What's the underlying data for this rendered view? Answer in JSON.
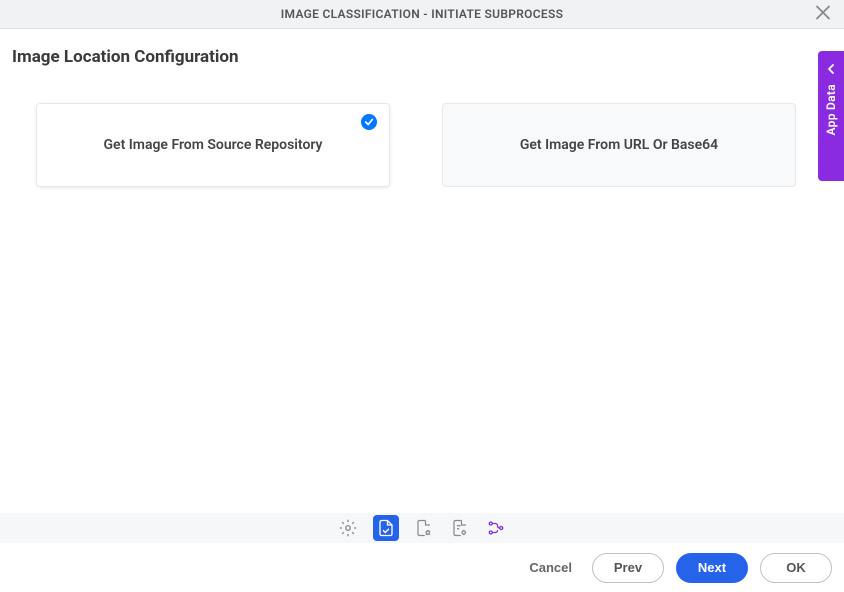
{
  "header": {
    "title": "IMAGE CLASSIFICATION - INITIATE SUBPROCESS"
  },
  "page": {
    "title": "Image Location Configuration"
  },
  "cards": [
    {
      "label": "Get Image From Source Repository",
      "selected": true
    },
    {
      "label": "Get Image From URL Or Base64",
      "selected": false
    }
  ],
  "sideTab": {
    "label": "App Data"
  },
  "footer": {
    "cancel": "Cancel",
    "prev": "Prev",
    "next": "Next",
    "ok": "OK"
  }
}
